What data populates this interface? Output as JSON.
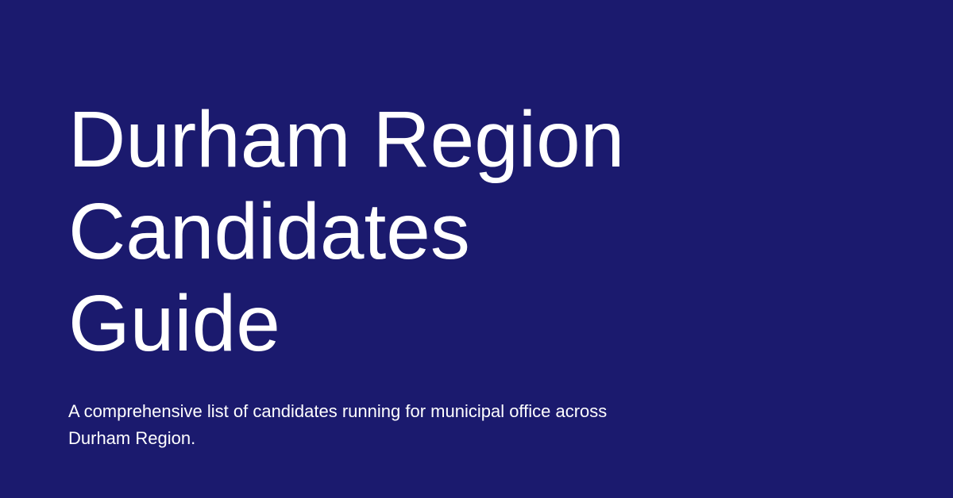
{
  "hero": {
    "title_lines": [
      "Durham Region",
      "Candidates",
      "Guide"
    ],
    "subtitle": "A comprehensive list of candidates running for municipal office across Durham Region."
  },
  "colors": {
    "background": "#1b1a6e",
    "text": "#ffffff"
  }
}
